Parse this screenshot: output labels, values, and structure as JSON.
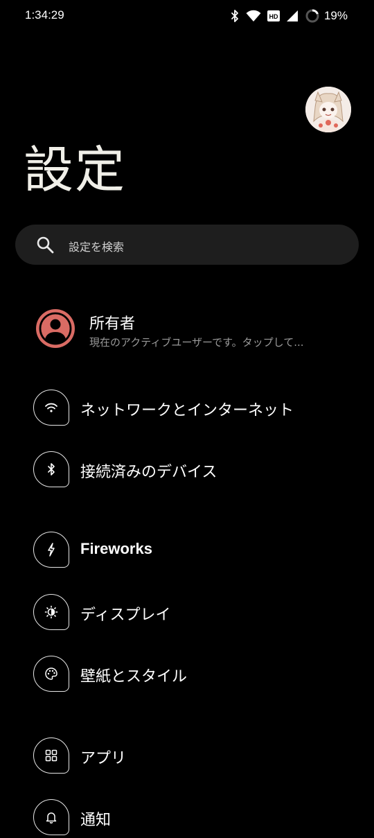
{
  "status_bar": {
    "time": "1:34:29",
    "hd_badge": "HD",
    "battery_percent": "19%",
    "battery_level": 0.19,
    "icons": [
      "bluetooth-icon",
      "wifi-icon",
      "hd-icon",
      "cell-signal-icon",
      "battery-ring-icon"
    ]
  },
  "header": {
    "title": "設定"
  },
  "search": {
    "placeholder": "設定を検索"
  },
  "owner": {
    "name": "所有者",
    "subtitle": "現在のアクティブユーザーです。タップして..."
  },
  "items": [
    {
      "label": "ネットワークとインターネット",
      "icon": "wifi-icon"
    },
    {
      "label": "接続済みのデバイス",
      "icon": "bluetooth-icon"
    },
    {
      "label": "Fireworks",
      "icon": "lightning-icon"
    },
    {
      "label": "ディスプレイ",
      "icon": "brightness-icon"
    },
    {
      "label": "壁紙とスタイル",
      "icon": "palette-icon"
    },
    {
      "label": "アプリ",
      "icon": "apps-grid-icon"
    },
    {
      "label": "通知",
      "icon": "bell-icon"
    }
  ],
  "colors": {
    "background": "#000000",
    "search_bg": "#1e1e1e",
    "owner_accent": "#d96b64",
    "secondary_text": "#9a9a9a",
    "title_text": "#f0efe8"
  }
}
